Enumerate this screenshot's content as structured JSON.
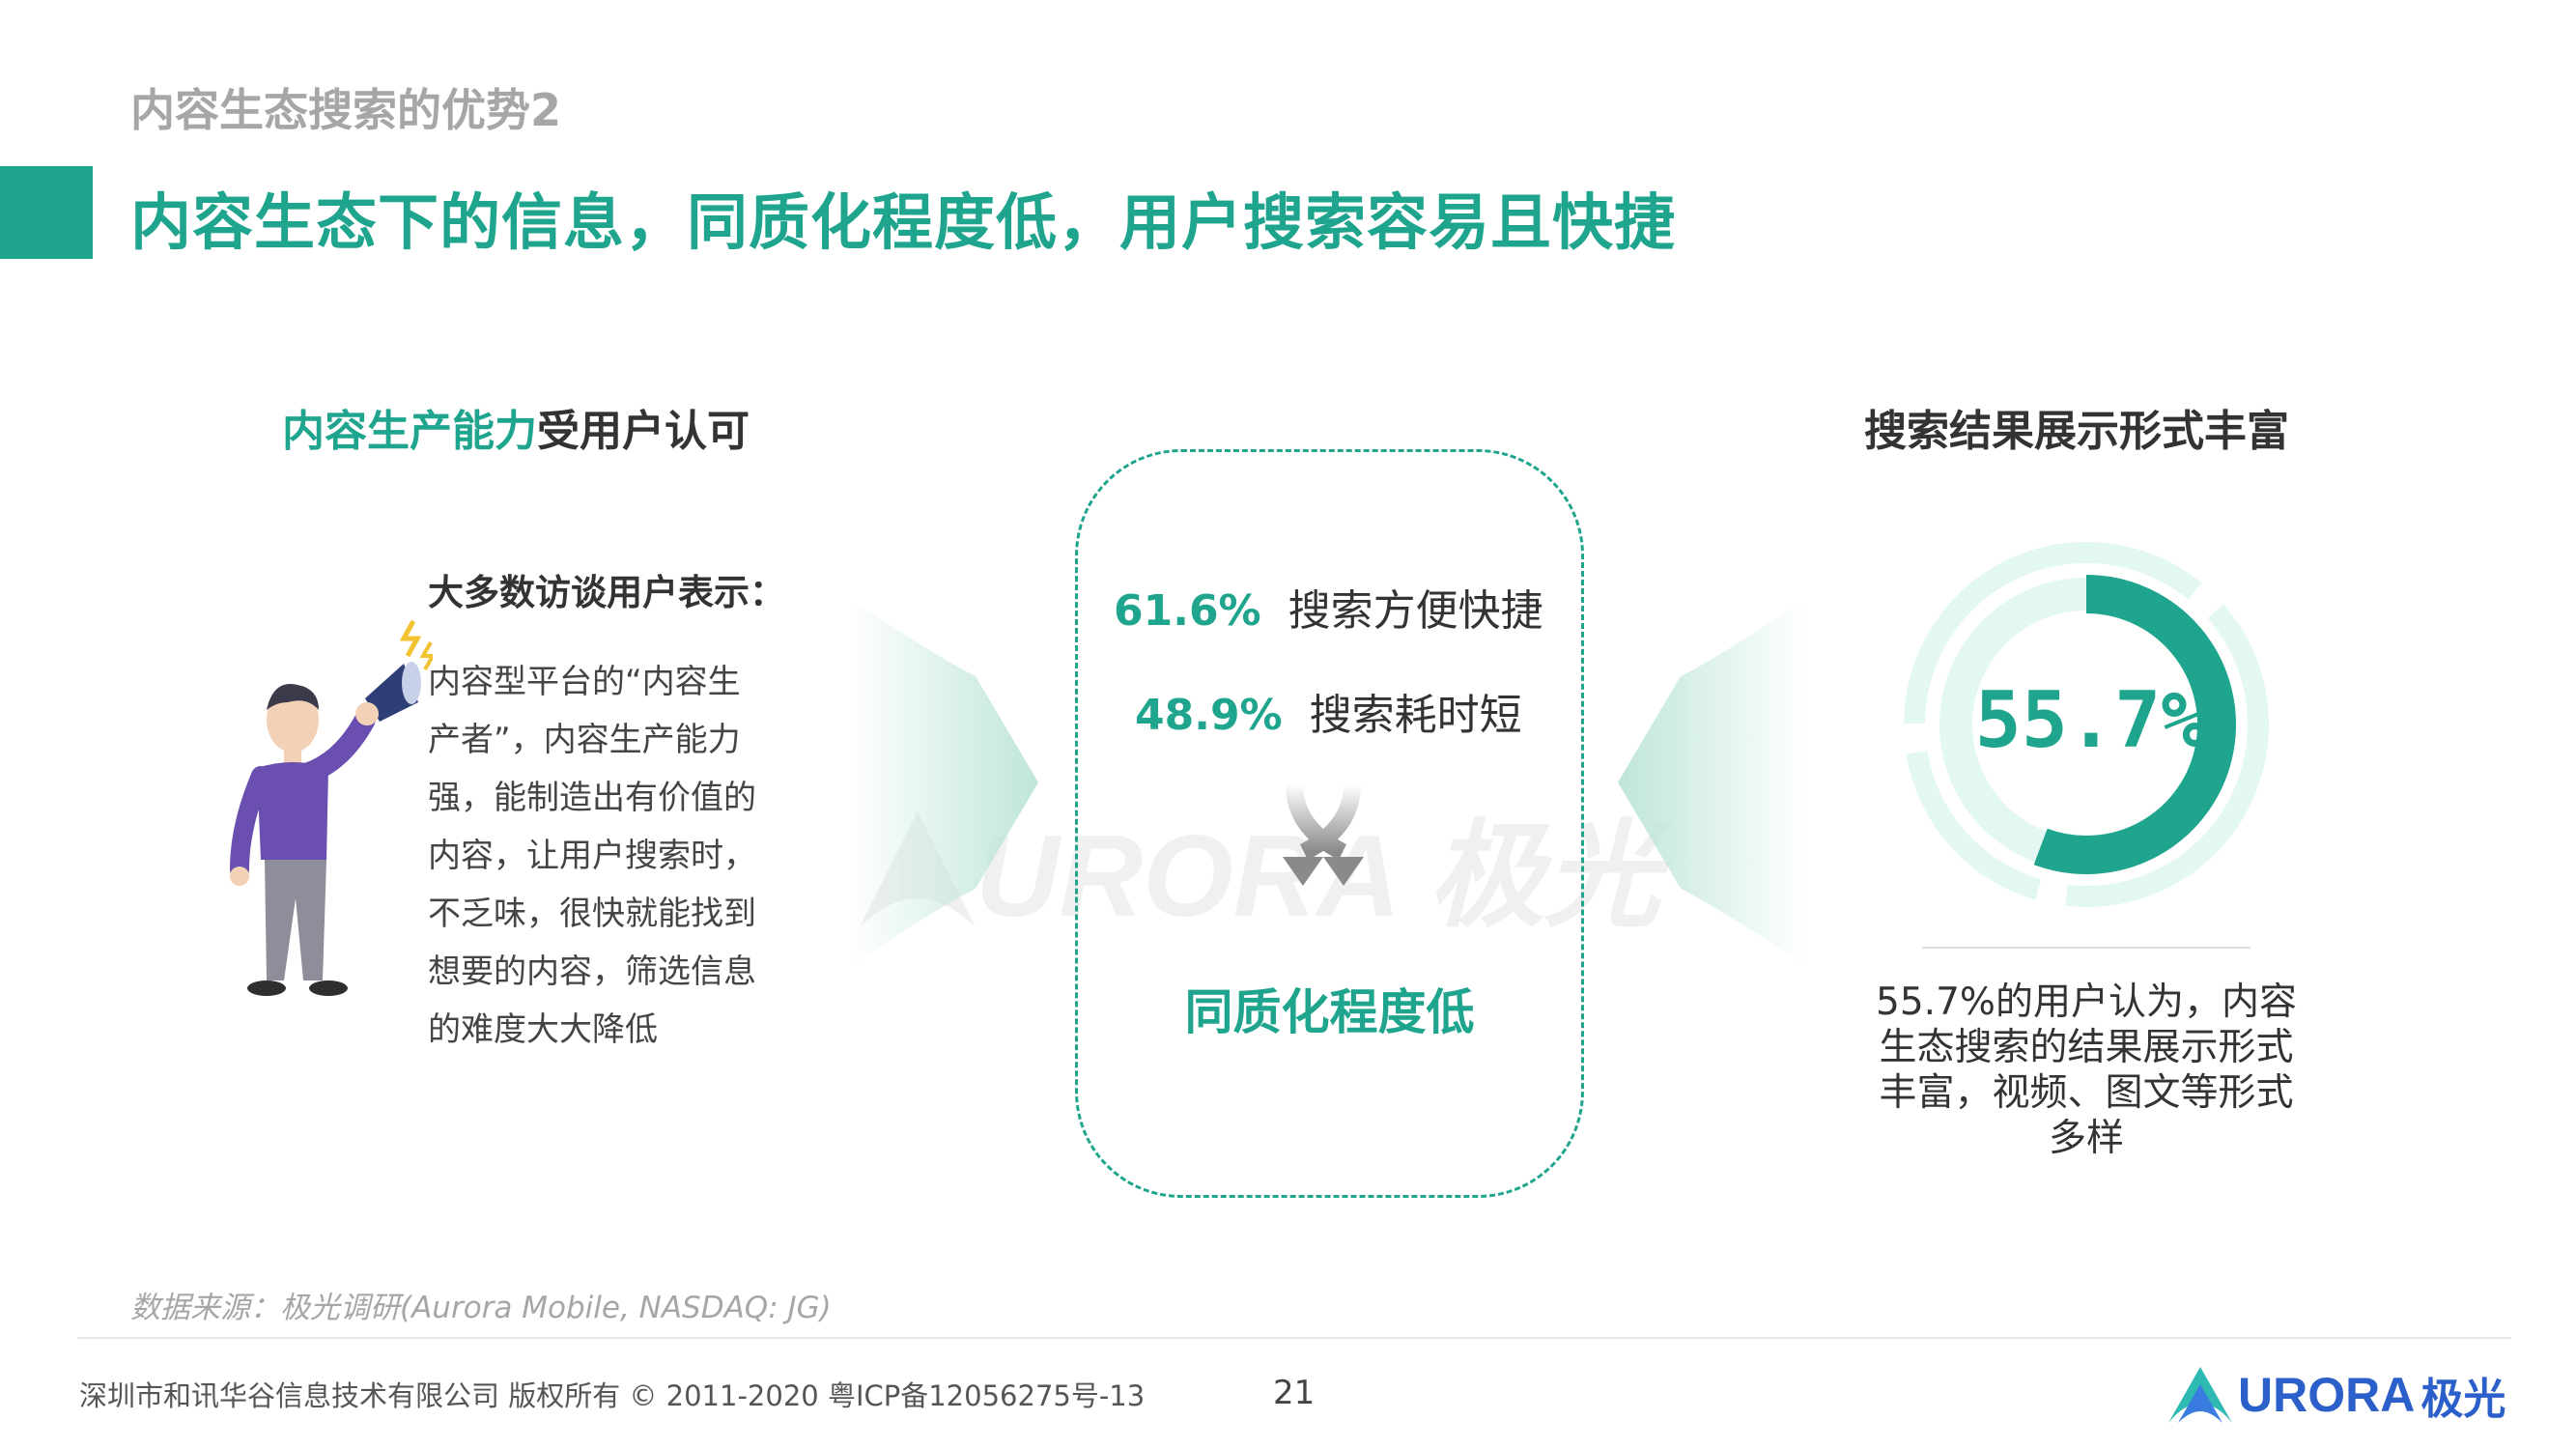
{
  "header": {
    "kicker": "内容生态搜索的优势2",
    "title": "内容生态下的信息，同质化程度低，用户搜索容易且快捷"
  },
  "left": {
    "heading_highlight": "内容生产能力",
    "heading_rest": "受用户认可",
    "subheading": "大多数访谈用户表示：",
    "body_lines": [
      "内容型平台的“内容生",
      "产者”，内容生产能力",
      "强，能制造出有价值的",
      "内容，让用户搜索时，",
      "不乏味，很快就能找到",
      "想要的内容，筛选信息",
      "的难度大大降低"
    ]
  },
  "center": {
    "stats": [
      {
        "pct": "61.6%",
        "label": "搜索方便快捷"
      },
      {
        "pct": "48.9%",
        "label": "搜索耗时短"
      }
    ],
    "conclusion": "同质化程度低"
  },
  "right": {
    "heading": "搜索结果展示形式丰富",
    "donut": {
      "value": 55.7,
      "label": "55.7%"
    },
    "body_lines": [
      "55.7%的用户认为，内容",
      "生态搜索的结果展示形式",
      "丰富，视频、图文等形式",
      "多样"
    ]
  },
  "watermark": {
    "text": "URORA 极光"
  },
  "source": "数据来源：极光调研(Aurora Mobile, NASDAQ: JG)",
  "footer": {
    "copyright": "深圳市和讯华谷信息技术有限公司 版权所有 © 2011-2020 粤ICP备12056275号-13",
    "page_number": "21",
    "logo_text": "URORA",
    "logo_cn": "极光"
  },
  "colors": {
    "accent": "#1fa58d",
    "donut_track": "#e3f7f3",
    "arrow_fill": "#bfe6d7",
    "muted_text": "#a6a6a6"
  }
}
